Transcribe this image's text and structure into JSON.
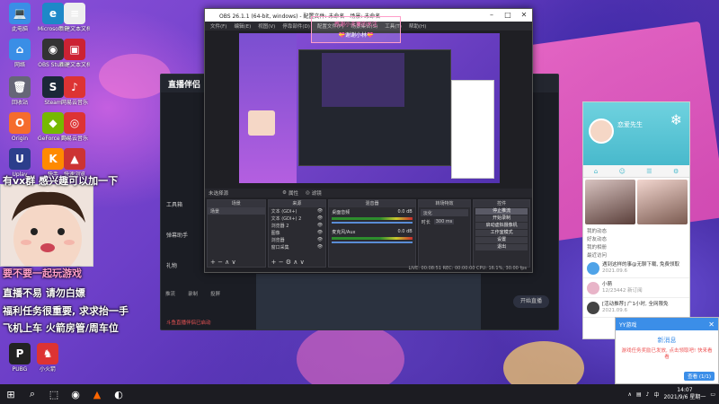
{
  "desktop_icons": [
    {
      "label": "此电脑",
      "color": "#3a8ee6",
      "glyph": "💻",
      "icon": "computer-icon"
    },
    {
      "label": "Microsoft Edge",
      "color": "#1e88c8",
      "glyph": "e",
      "icon": "edge-icon"
    },
    {
      "label": "新建文本文档",
      "color": "#eeeeee",
      "glyph": "≡",
      "icon": "text-document-icon"
    },
    {
      "label": "网络",
      "color": "#3a8ee6",
      "glyph": "⌂",
      "icon": "network-icon"
    },
    {
      "label": "OBS Studio",
      "color": "#333",
      "glyph": "◉",
      "icon": "obs-icon"
    },
    {
      "label": "新建文本文档",
      "color": "#c23",
      "glyph": "▣",
      "icon": "document-icon"
    },
    {
      "label": "回收站",
      "color": "#667",
      "glyph": "🗑",
      "icon": "recycle-bin-icon"
    },
    {
      "label": "Steam",
      "color": "#1b2838",
      "glyph": "S",
      "icon": "steam-icon"
    },
    {
      "label": "网易云音乐",
      "color": "#d33",
      "glyph": "♪",
      "icon": "music-icon"
    },
    {
      "label": "Origin",
      "color": "#f56c2d",
      "glyph": "O",
      "icon": "origin-icon"
    },
    {
      "label": "GeForce Experience",
      "color": "#76b900",
      "glyph": "◆",
      "icon": "geforce-icon"
    },
    {
      "label": "网易云音乐",
      "color": "#d33",
      "glyph": "◎",
      "icon": "netease-icon"
    },
    {
      "label": "Uplay",
      "color": "#2c3e8c",
      "glyph": "U",
      "icon": "uplay-icon"
    },
    {
      "label": "快手",
      "color": "#ff8a00",
      "glyph": "K",
      "icon": "kuaishou-icon"
    },
    {
      "label": "快速浏览",
      "color": "#c33",
      "glyph": "▲",
      "icon": "browser-icon"
    },
    {
      "label": "PUBG",
      "color": "#222",
      "glyph": "P",
      "icon": "pubg-icon"
    },
    {
      "label": "小火箭",
      "color": "#d33",
      "glyph": "♞",
      "icon": "game-icon"
    }
  ],
  "obs": {
    "title": "OBS 26.1.1 (64-bit, windows) - 配置文件: 未命名 - 场景: 未命名",
    "overlay_title": "感谢小夫妻的关注",
    "overlay_sub": "💝谢谢小林💝",
    "menu": [
      "文件(F)",
      "编辑(E)",
      "视图(V)",
      "停靠部件(D)",
      "配置文件(P)",
      "场景集合(S)",
      "工具(T)",
      "帮助(H)"
    ],
    "dock_bar": "未选择源",
    "dock_bar_props": "属性",
    "dock_bar_filters": "滤镜",
    "docks": {
      "scenes": {
        "title": "场景",
        "items": [
          "场景"
        ]
      },
      "sources": {
        "title": "来源",
        "items": [
          "文本 (GDI+)",
          "文本 (GDI+) 2",
          "浏览器 2",
          "图像",
          "浏览器",
          "窗口采集"
        ]
      },
      "mixer": {
        "title": "混音器",
        "items": [
          {
            "name": "桌面音频",
            "db": "0.0 dB"
          },
          {
            "name": "麦克风/Aux",
            "db": "0.0 dB"
          }
        ]
      },
      "transitions": {
        "title": "转场特效",
        "type": "淡化",
        "duration_label": "时长",
        "duration": "300 ms"
      },
      "controls": {
        "title": "控件",
        "buttons": [
          "停止推流",
          "开始录制",
          "启动虚拟摄像机",
          "工作室模式",
          "设置",
          "退出"
        ]
      }
    },
    "status": "LIVE: 00:08:51   REC: 00:00:00   CPU: 16.1%, 30.00 fps"
  },
  "live_app": {
    "title": "直播伴侣",
    "sidebar": [
      "工具箱",
      "弹幕助手",
      "礼物",
      "开始直播",
      "发现",
      "设置"
    ],
    "footer": "斗鱼直播伴侣已启动",
    "start_button": "开始直播",
    "bottom_icons": [
      "推流",
      "录制",
      "投屏",
      "导出"
    ]
  },
  "overlays": {
    "line1": "有vx群  感兴趣可以加一下",
    "line2": "要不要一起玩游戏",
    "line3": "直播不易  请勿白嫖",
    "line4": "福利任务很重要, 求求抬一手",
    "line5": "飞机上车  火箭房管/周车位"
  },
  "qq": {
    "name": "恋爱先生",
    "tabs": [
      "主页",
      "好友",
      "动态",
      "设置"
    ],
    "entries": [
      "我的动态",
      "好友动态",
      "我的相册",
      "最近访问"
    ],
    "messages": [
      {
        "title": "遇到这样的事@无聊下载, 免费领取",
        "meta": "2021.09.6"
      },
      {
        "title": "小萌",
        "meta": "12/23442  新订阅"
      },
      {
        "title": "[活动推荐] 广1小时, 全网限免",
        "meta": "2021.09.6"
      }
    ]
  },
  "notification": {
    "app": "YY游戏",
    "title": "新消息",
    "body": "游戏任务奖励已发放, 点击领取吧! 快来看看",
    "button": "查看 (1/1)"
  },
  "taskbar": {
    "time": "14:07",
    "date": "2021/9/6 星期一",
    "lang": "中",
    "items": [
      "⊞",
      "⌕",
      "⬚",
      "◉",
      "▲",
      "◐"
    ]
  }
}
